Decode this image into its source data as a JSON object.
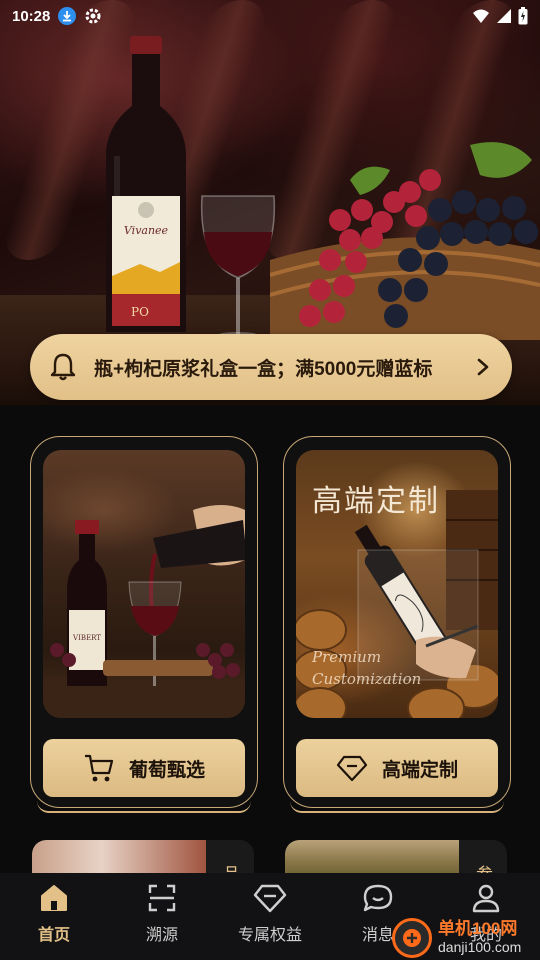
{
  "status_bar": {
    "time": "10:28"
  },
  "banner": {
    "notice_text": "瓶+枸杞原浆礼盒一盒；满5000元赠蓝标"
  },
  "cards": [
    {
      "button_label": "葡萄甄选"
    },
    {
      "button_label": "高端定制",
      "image_title": "高端定制",
      "image_subtitle_1": "Premium",
      "image_subtitle_2": "Customization"
    }
  ],
  "previews": [
    {
      "side_char": "品"
    },
    {
      "side_char": "参"
    }
  ],
  "nav": {
    "items": [
      {
        "label": "首页",
        "icon": "home-icon",
        "active": true
      },
      {
        "label": "溯源",
        "icon": "scan-icon",
        "active": false
      },
      {
        "label": "专属权益",
        "icon": "diamond-icon",
        "active": false
      },
      {
        "label": "消息",
        "icon": "message-icon",
        "active": false
      },
      {
        "label": "我的",
        "icon": "user-icon",
        "active": false
      }
    ]
  },
  "watermark": {
    "name": "单机100网",
    "url": "danji100.com"
  },
  "colors": {
    "gold": "#e2c088",
    "background": "#0b0b0c",
    "nav_bg": "#121214"
  }
}
